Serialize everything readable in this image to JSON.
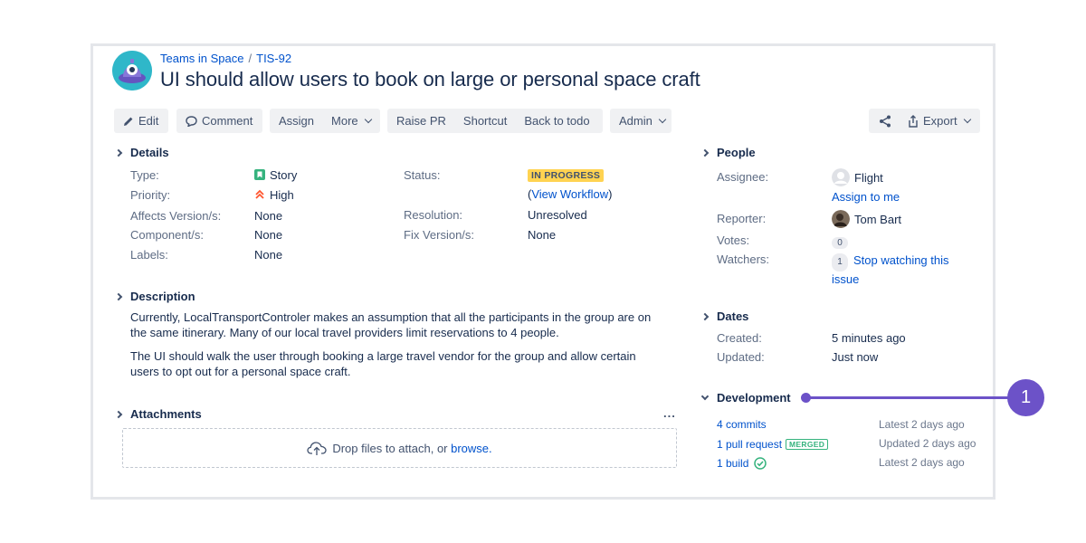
{
  "breadcrumb": {
    "project": "Teams in Space",
    "separator": "/",
    "issue_key": "TIS-92"
  },
  "issue": {
    "title": "UI should allow users to book on large or personal space craft"
  },
  "toolbar": {
    "edit": "Edit",
    "comment": "Comment",
    "assign": "Assign",
    "more": "More",
    "raise_pr": "Raise PR",
    "shortcut": "Shortcut",
    "back_to_todo": "Back to todo",
    "admin": "Admin",
    "export": "Export"
  },
  "details": {
    "heading": "Details",
    "type_label": "Type:",
    "type_value": "Story",
    "priority_label": "Priority:",
    "priority_value": "High",
    "affects_label": "Affects Version/s:",
    "affects_value": "None",
    "component_label": "Component/s:",
    "component_value": "None",
    "labels_label": "Labels:",
    "labels_value": "None",
    "status_label": "Status:",
    "status_value": "IN PROGRESS",
    "view_workflow_open": "(",
    "view_workflow": "View Workflow",
    "view_workflow_close": ")",
    "resolution_label": "Resolution:",
    "resolution_value": "Unresolved",
    "fix_label": "Fix Version/s:",
    "fix_value": "None"
  },
  "description": {
    "heading": "Description",
    "paragraph1": "Currently, LocalTransportControler makes an assumption that all the participants in the group are on the same itinerary. Many of our local travel providers limit reservations to 4 people.",
    "paragraph2": "The UI should walk the user through booking a large travel vendor for the group and allow certain users to opt out for a personal space craft."
  },
  "attachments": {
    "heading": "Attachments",
    "more": "...",
    "drop_text": "Drop files to attach, or",
    "browse": "browse."
  },
  "people": {
    "heading": "People",
    "assignee_label": "Assignee:",
    "assignee_value": "Flight",
    "assign_to_me": "Assign to me",
    "reporter_label": "Reporter:",
    "reporter_value": "Tom Bart",
    "votes_label": "Votes:",
    "votes_count": "0",
    "watchers_label": "Watchers:",
    "watchers_count": "1",
    "stop_watching_line1": "Stop watching this",
    "stop_watching_line2": "issue"
  },
  "dates": {
    "heading": "Dates",
    "created_label": "Created:",
    "created_value": "5 minutes ago",
    "updated_label": "Updated:",
    "updated_value": "Just now"
  },
  "development": {
    "heading": "Development",
    "commits": "4 commits",
    "commits_meta": "Latest 2 days ago",
    "pull_request": "1 pull request",
    "merged_badge": "MERGED",
    "pull_request_meta": "Updated 2 days ago",
    "build": "1 build",
    "build_meta": "Latest 2 days ago"
  },
  "callout": {
    "number": "1"
  },
  "colors": {
    "link": "#0052cc",
    "status_yellow": "#ffd351",
    "merged_green": "#36b37e",
    "callout_purple": "#6c52c8",
    "project_avatar": "#2fb7c9"
  }
}
